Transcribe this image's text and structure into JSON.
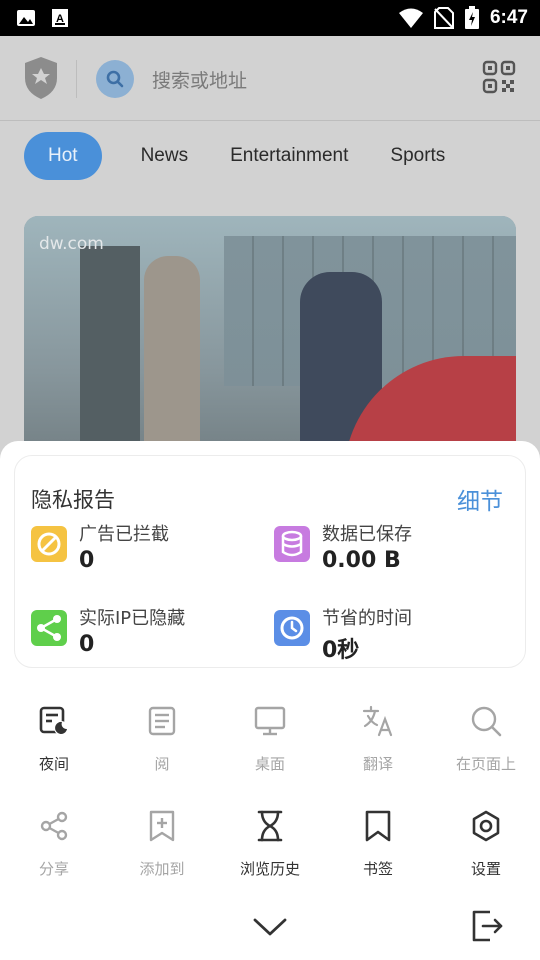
{
  "status_bar": {
    "time": "6:47",
    "icons": [
      "image-icon",
      "text-icon",
      "wifi-icon",
      "no-sim-icon",
      "battery-charging-icon"
    ]
  },
  "search": {
    "placeholder": "搜索或地址"
  },
  "tabs": [
    {
      "label": "Hot",
      "active": true
    },
    {
      "label": "News",
      "active": false
    },
    {
      "label": "Entertainment",
      "active": false
    },
    {
      "label": "Sports",
      "active": false
    }
  ],
  "news_card": {
    "source": "dw.com"
  },
  "privacy_report": {
    "title": "隐私报告",
    "details_link": "细节",
    "stats": [
      {
        "label": "广告已拦截",
        "value": "0",
        "icon": "ad-block-icon",
        "color": "#f5c342"
      },
      {
        "label": "数据已保存",
        "value": "0.00 B",
        "icon": "database-icon",
        "color": "#c77be0"
      },
      {
        "label": "实际IP已隐藏",
        "value": "0",
        "icon": "share-nodes-icon",
        "color": "#5fcf4b"
      },
      {
        "label": "节省的时间",
        "value": "0秒",
        "icon": "clock-icon",
        "color": "#5b8ee6"
      }
    ]
  },
  "menu": {
    "row1": [
      {
        "label": "夜间",
        "icon": "night-mode-icon",
        "enabled": true
      },
      {
        "label": "阅",
        "icon": "reader-icon",
        "enabled": false
      },
      {
        "label": "桌面",
        "icon": "desktop-icon",
        "enabled": false
      },
      {
        "label": "翻译",
        "icon": "translate-icon",
        "enabled": false
      },
      {
        "label": "在页面上",
        "icon": "find-in-page-icon",
        "enabled": false
      }
    ],
    "row2": [
      {
        "label": "分享",
        "icon": "share-icon",
        "enabled": false
      },
      {
        "label": "添加到",
        "icon": "add-bookmark-icon",
        "enabled": false
      },
      {
        "label": "浏览历史",
        "icon": "history-icon",
        "enabled": true
      },
      {
        "label": "书签",
        "icon": "bookmark-icon",
        "enabled": true
      },
      {
        "label": "设置",
        "icon": "settings-icon",
        "enabled": true
      }
    ]
  },
  "colors": {
    "accent": "#4a90d9",
    "disabled": "#a5a5a5"
  }
}
